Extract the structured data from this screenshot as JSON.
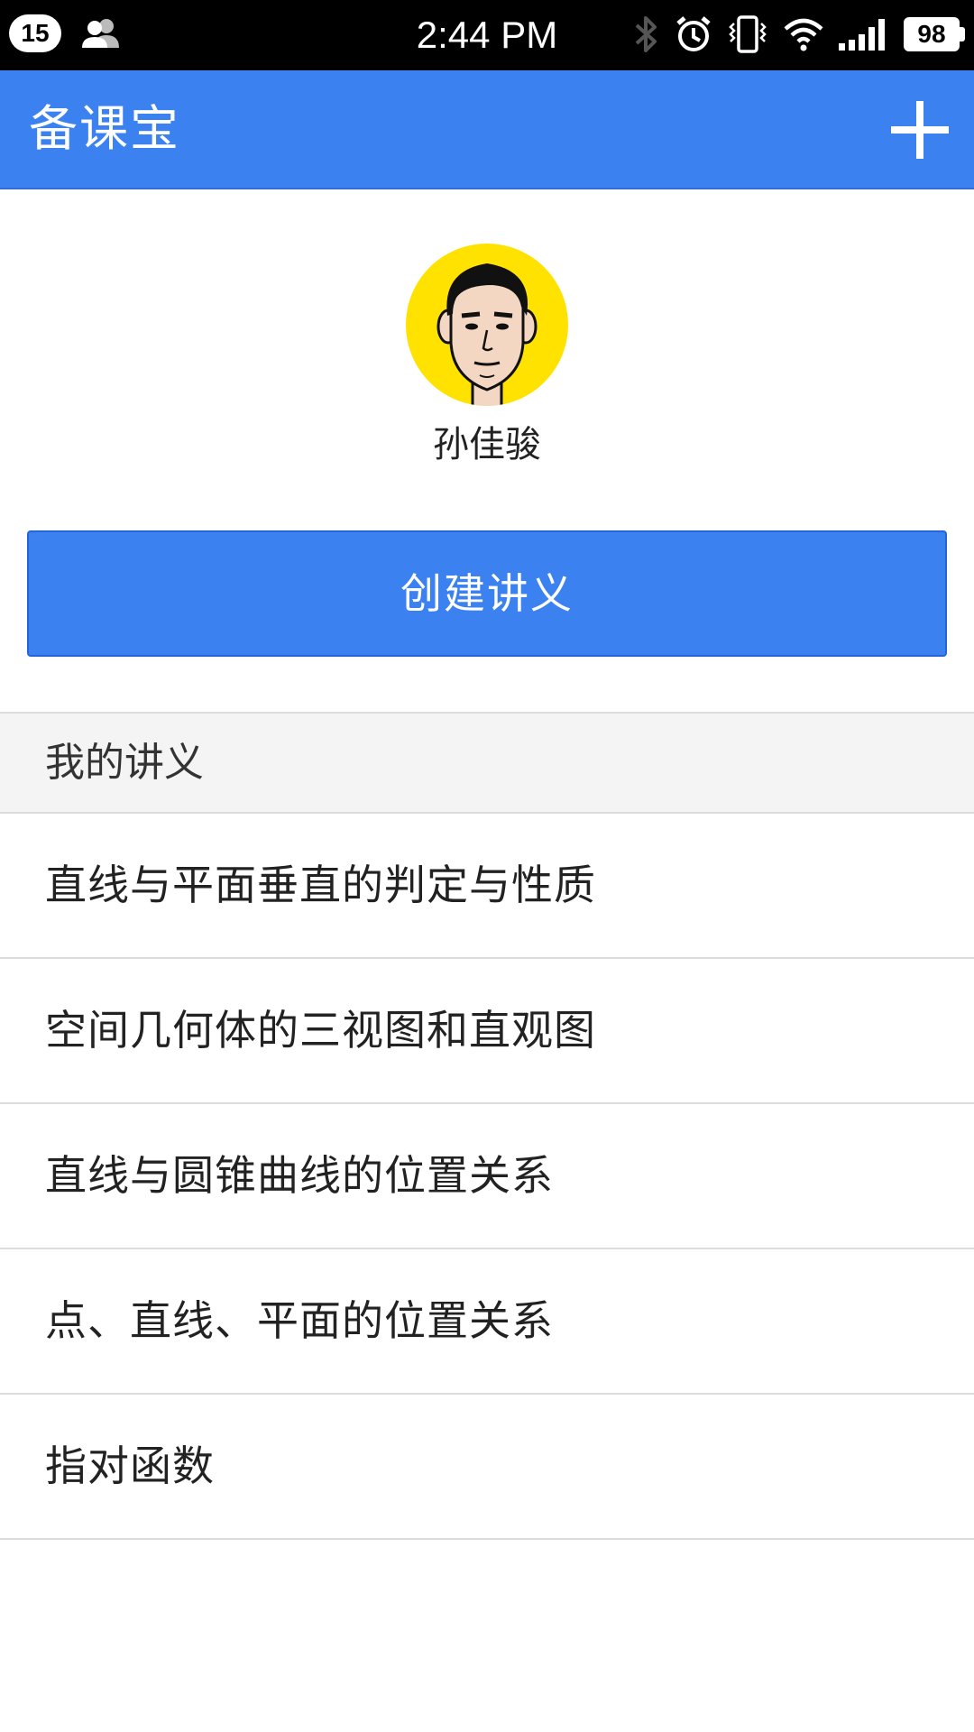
{
  "status_bar": {
    "notification_count": "15",
    "time": "2:44 PM",
    "battery": "98"
  },
  "app_bar": {
    "title": "备课宝",
    "add_icon": "plus-icon"
  },
  "profile": {
    "avatar_icon": "avatar-face-icon",
    "name": "孙佳骏"
  },
  "create_button": {
    "label": "创建讲义"
  },
  "section": {
    "title": "我的讲义"
  },
  "lectures": [
    {
      "title": "直线与平面垂直的判定与性质"
    },
    {
      "title": "空间几何体的三视图和直观图"
    },
    {
      "title": "直线与圆锥曲线的位置关系"
    },
    {
      "title": "点、直线、平面的位置关系"
    },
    {
      "title": "指对函数"
    }
  ],
  "colors": {
    "primary": "#3b81f0",
    "avatar_bg": "#ffe200",
    "section_bg": "#f4f4f4",
    "divider": "#dcdcdc"
  }
}
